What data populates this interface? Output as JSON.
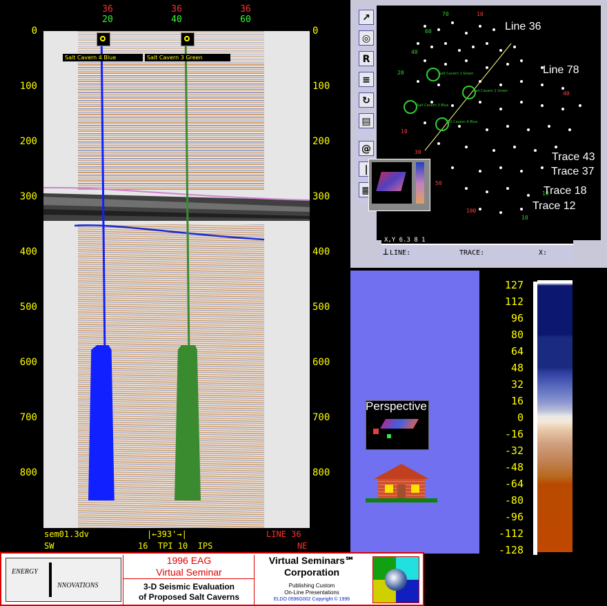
{
  "seismic": {
    "top_line_numbers": [
      "36",
      "36",
      "36"
    ],
    "top_trace_numbers": [
      "20",
      "40",
      "60"
    ],
    "depth_labels": [
      "0",
      "100",
      "200",
      "300",
      "400",
      "500",
      "600",
      "700",
      "800"
    ],
    "well_tag_blue": "Salt Cavern 4 Blue",
    "well_tag_green": "Salt Cavern 3 Green",
    "file_name": "sem01.3dv",
    "scale_text": "393'",
    "line_label": "LINE 36",
    "sw_label": "SW",
    "ne_label": "NE",
    "tpi_text": "16  TPI 10  IPS",
    "colors": {
      "blue_well": "#1020ff",
      "green_well": "#3a8a30",
      "horizon_pink": "#d080d0",
      "horizon_blue": "#1a2ad0"
    }
  },
  "basemap": {
    "tools": [
      "select-tool-icon",
      "zoom-tool-icon",
      "R",
      "list-tool-icon",
      "rotate-tool-icon",
      "page-tool-icon",
      "spiral-tool-icon",
      "bar-tool-icon",
      "grid-tool-icon"
    ],
    "labels": {
      "line36": "Line 36",
      "line78": "Line 78",
      "trace43": "Trace 43",
      "trace37": "Trace 37",
      "trace18": "Trace 18",
      "trace12": "Trace 12"
    },
    "status": {
      "line": "LINE:",
      "trace": "TRACE:",
      "x": "X:",
      "partial": "X,Y  6.3 8 1"
    },
    "cavern_labels": [
      "Salt Cavern 1 Green",
      "Salt Cavern 2 Green",
      "Salt Cavern 3 Blue",
      "Salt Cavern 4 Blue"
    ]
  },
  "lower": {
    "perspective_label": "Perspective"
  },
  "colorbar": {
    "ticks": [
      "127",
      "112",
      "96",
      "80",
      "64",
      "48",
      "32",
      "16",
      "0",
      "-16",
      "-32",
      "-48",
      "-64",
      "-80",
      "-96",
      "-112",
      "-128"
    ]
  },
  "footer": {
    "logo_line1": "ENERGY",
    "logo_line2": "NNOVATIONS",
    "seminar_title1": "1996 EAG",
    "seminar_title2": "Virtual Seminar",
    "topic1": "3-D Seismic Evaluation",
    "topic2": "of Proposed Salt Caverns",
    "corp1": "Virtual Seminars℠",
    "corp2": "Corporation",
    "pub1": "Publishing Custom",
    "pub2": "On-Line Presentations",
    "copyright": "ELDO 0596G002 Copyright © 1996"
  }
}
